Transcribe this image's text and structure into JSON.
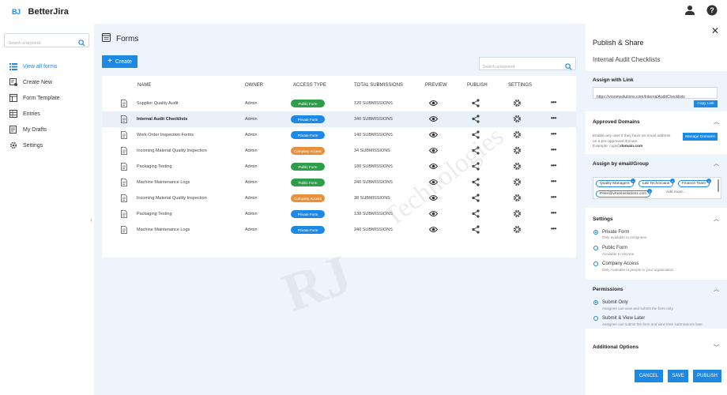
{
  "app": {
    "logo_mark": "BJ",
    "name": "BetterJira"
  },
  "sidebar": {
    "search_placeholder": "Search a keyword",
    "items": [
      {
        "label": "View all forms",
        "active": true
      },
      {
        "label": "Create New"
      },
      {
        "label": "Form Template"
      },
      {
        "label": "Entries"
      },
      {
        "label": "My Drafts"
      },
      {
        "label": "Settings"
      }
    ]
  },
  "main": {
    "title": "Forms",
    "create_label": "Create",
    "search_placeholder": "Search a keyword",
    "columns": [
      "NAME",
      "OWNER",
      "ACCESS TYPE",
      "TOTAL SUBMISSIONS",
      "PREVIEW",
      "PUBLISH",
      "SETTINGS"
    ],
    "rows": [
      {
        "name": "Supplier Quality Audit",
        "owner": "Admin",
        "access": "Public Form",
        "submissions": "120 SUBMISSIONS"
      },
      {
        "name": "Internal Audit Checklists",
        "owner": "Admin",
        "access": "Private Form",
        "submissions": "340 SUBMISSIONS",
        "selected": true
      },
      {
        "name": "Work Order Inspection Forms",
        "owner": "Admin",
        "access": "Private Form",
        "submissions": "140 SUBMISSIONS"
      },
      {
        "name": "Incoming Material Quality Inspection",
        "owner": "Admin",
        "access": "Company Access",
        "submissions": "34 SUBMISSIONS"
      },
      {
        "name": "Packaging Testing",
        "owner": "Admin",
        "access": "Public Form",
        "submissions": "180 SUBMISSIONS"
      },
      {
        "name": "Machine Maintenance Logs",
        "owner": "Admin",
        "access": "Public Form",
        "submissions": "240 SUBMISSIONS"
      },
      {
        "name": "Incoming Material Quality Inspection",
        "owner": "Admin",
        "access": "Company Access",
        "submissions": "38 SUBMISSIONS"
      },
      {
        "name": "Packaging Testing",
        "owner": "Admin",
        "access": "Private Form",
        "submissions": "138 SUBMISSIONS"
      },
      {
        "name": "Machine Maintenance Logs",
        "owner": "Admin",
        "access": "Private Form",
        "submissions": "240 SUBMISSIONS"
      }
    ],
    "more_label": "•••"
  },
  "watermark": {
    "text": "Technologies",
    "logo": "RJ"
  },
  "colors": {
    "accent": "#1e88e5",
    "public": "#2e9e4b",
    "private": "#1e88e5",
    "company": "#e8913a"
  },
  "panel": {
    "title": "Publish & Share",
    "subtitle": "Internal Audit Checklists",
    "assign_link": {
      "title": "Assign with Link",
      "url": "https://vroomsolutions.com/InternalAuditChecklists",
      "copy_label": "Copy Link"
    },
    "approved_domains": {
      "title": "Approved Domains",
      "desc_line1": "Enable any user if they have an email address",
      "desc_line2": "on a pre-approved domain.",
      "example_prefix": "Example: cuja@",
      "example_domain": "domain.com",
      "manage_label": "Manage Domains"
    },
    "assign_email": {
      "title": "Assign by email/Group",
      "tags": [
        "Quality Managers",
        "Lab Technicians",
        "Finance Team",
        "Peter@vroomsolutions.com"
      ],
      "add_more": "Add more..."
    },
    "settings": {
      "title": "Settings",
      "options": [
        {
          "label": "Private Form",
          "desc": "Only available to Assignees",
          "checked": true
        },
        {
          "label": "Public Form",
          "desc": "Available to Anyone"
        },
        {
          "label": "Company Access",
          "desc": "Only Available to people in your organisation"
        }
      ]
    },
    "permissions": {
      "title": "Permissions",
      "options": [
        {
          "label": "Submit Only",
          "desc": "Assignee can view and submit the form only.",
          "checked": true
        },
        {
          "label": "Submit & View Later",
          "desc": "Assignee can submit the form and view their submissions later."
        }
      ]
    },
    "additional": {
      "title": "Additional Options"
    },
    "buttons": {
      "cancel": "CANCEL",
      "save": "SAVE",
      "publish": "PUBLISH"
    }
  }
}
